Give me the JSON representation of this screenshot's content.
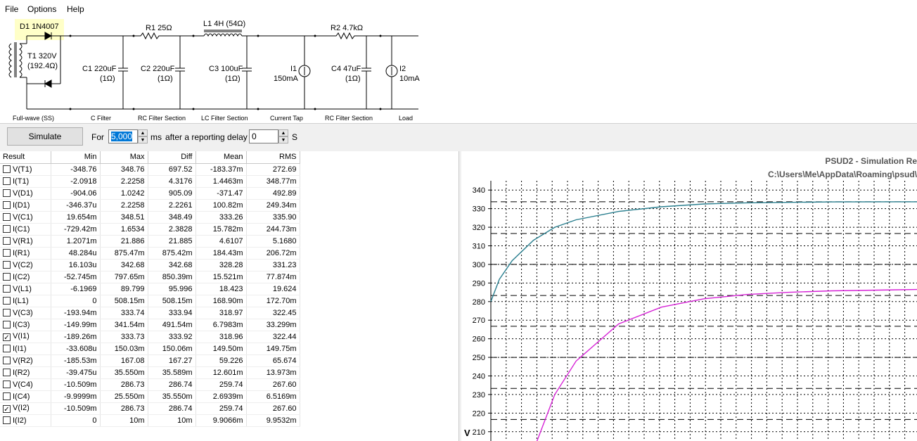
{
  "menu": {
    "file": "File",
    "options": "Options",
    "help": "Help"
  },
  "schematic": {
    "d1": "D1 1N4007",
    "t1_line1": "T1 320V",
    "t1_line2": "(192.4Ω)",
    "r1": "R1 25Ω",
    "l1": "L1 4H (54Ω)",
    "r2": "R2 4.7kΩ",
    "c1_line1": "C1 220uF",
    "c1_line2": "(1Ω)",
    "c2_line1": "C2 220uF",
    "c2_line2": "(1Ω)",
    "c3_line1": "C3 100uF",
    "c3_line2": "(1Ω)",
    "i1_line1": "I1",
    "i1_line2": "150mA",
    "c4_line1": "C4 47uF",
    "c4_line2": "(1Ω)",
    "i2_line1": "I2",
    "i2_line2": "10mA",
    "sections": [
      "Full-wave (SS)",
      "C Filter",
      "RC Filter Section",
      "LC Filter Section",
      "Current Tap",
      "RC Filter Section",
      "Load"
    ]
  },
  "controls": {
    "simulate": "Simulate",
    "for": "For",
    "duration": "5,000",
    "ms": "ms",
    "after": "after a reporting delay of",
    "delay": "0",
    "s": "S"
  },
  "table": {
    "headers": [
      "Result",
      "Min",
      "Max",
      "Diff",
      "Mean",
      "RMS"
    ],
    "rows": [
      {
        "name": "V(T1)",
        "checked": false,
        "min": "-348.76",
        "max": "348.76",
        "diff": "697.52",
        "mean": "-183.37m",
        "rms": "272.69"
      },
      {
        "name": "I(T1)",
        "checked": false,
        "min": "-2.0918",
        "max": "2.2258",
        "diff": "4.3176",
        "mean": "1.4463m",
        "rms": "348.77m"
      },
      {
        "name": "V(D1)",
        "checked": false,
        "min": "-904.06",
        "max": "1.0242",
        "diff": "905.09",
        "mean": "-371.47",
        "rms": "492.89"
      },
      {
        "name": "I(D1)",
        "checked": false,
        "min": "-346.37u",
        "max": "2.2258",
        "diff": "2.2261",
        "mean": "100.82m",
        "rms": "249.34m"
      },
      {
        "name": "V(C1)",
        "checked": false,
        "min": "19.654m",
        "max": "348.51",
        "diff": "348.49",
        "mean": "333.26",
        "rms": "335.90"
      },
      {
        "name": "I(C1)",
        "checked": false,
        "min": "-729.42m",
        "max": "1.6534",
        "diff": "2.3828",
        "mean": "15.782m",
        "rms": "244.73m"
      },
      {
        "name": "V(R1)",
        "checked": false,
        "min": "1.2071m",
        "max": "21.886",
        "diff": "21.885",
        "mean": "4.6107",
        "rms": "5.1680"
      },
      {
        "name": "I(R1)",
        "checked": false,
        "min": "48.284u",
        "max": "875.47m",
        "diff": "875.42m",
        "mean": "184.43m",
        "rms": "206.72m"
      },
      {
        "name": "V(C2)",
        "checked": false,
        "min": "16.103u",
        "max": "342.68",
        "diff": "342.68",
        "mean": "328.28",
        "rms": "331.23"
      },
      {
        "name": "I(C2)",
        "checked": false,
        "min": "-52.745m",
        "max": "797.65m",
        "diff": "850.39m",
        "mean": "15.521m",
        "rms": "77.874m"
      },
      {
        "name": "V(L1)",
        "checked": false,
        "min": "-6.1969",
        "max": "89.799",
        "diff": "95.996",
        "mean": "18.423",
        "rms": "19.624"
      },
      {
        "name": "I(L1)",
        "checked": false,
        "min": "0",
        "max": "508.15m",
        "diff": "508.15m",
        "mean": "168.90m",
        "rms": "172.70m"
      },
      {
        "name": "V(C3)",
        "checked": false,
        "min": "-193.94m",
        "max": "333.74",
        "diff": "333.94",
        "mean": "318.97",
        "rms": "322.45"
      },
      {
        "name": "I(C3)",
        "checked": false,
        "min": "-149.99m",
        "max": "341.54m",
        "diff": "491.54m",
        "mean": "6.7983m",
        "rms": "33.299m"
      },
      {
        "name": "V(I1)",
        "checked": true,
        "min": "-189.26m",
        "max": "333.73",
        "diff": "333.92",
        "mean": "318.96",
        "rms": "322.44"
      },
      {
        "name": "I(I1)",
        "checked": false,
        "min": "-33.608u",
        "max": "150.03m",
        "diff": "150.06m",
        "mean": "149.50m",
        "rms": "149.75m"
      },
      {
        "name": "V(R2)",
        "checked": false,
        "min": "-185.53m",
        "max": "167.08",
        "diff": "167.27",
        "mean": "59.226",
        "rms": "65.674"
      },
      {
        "name": "I(R2)",
        "checked": false,
        "min": "-39.475u",
        "max": "35.550m",
        "diff": "35.589m",
        "mean": "12.601m",
        "rms": "13.973m"
      },
      {
        "name": "V(C4)",
        "checked": false,
        "min": "-10.509m",
        "max": "286.73",
        "diff": "286.74",
        "mean": "259.74",
        "rms": "267.60"
      },
      {
        "name": "I(C4)",
        "checked": false,
        "min": "-9.9999m",
        "max": "25.550m",
        "diff": "35.550m",
        "mean": "2.6939m",
        "rms": "6.5169m"
      },
      {
        "name": "V(I2)",
        "checked": true,
        "min": "-10.509m",
        "max": "286.73",
        "diff": "286.74",
        "mean": "259.74",
        "rms": "267.60"
      },
      {
        "name": "I(I2)",
        "checked": false,
        "min": "0",
        "max": "10m",
        "diff": "10m",
        "mean": "9.9066m",
        "rms": "9.9532m"
      }
    ]
  },
  "graph": {
    "title1": "PSUD2 - Simulation Re",
    "title2": "C:\\Users\\Me\\AppData\\Roaming\\psud\\",
    "ylabel": "V",
    "yticks": [
      "340",
      "330",
      "320",
      "310",
      "300",
      "290",
      "280",
      "270",
      "260",
      "250",
      "240",
      "230",
      "220",
      "210"
    ]
  },
  "chart_data": {
    "type": "line",
    "ylabel": "V",
    "ylim": [
      205,
      345
    ],
    "yticks": [
      340,
      330,
      320,
      310,
      300,
      290,
      280,
      270,
      260,
      250,
      240,
      230,
      220,
      210
    ],
    "grid": true,
    "series": [
      {
        "color": "#2a7f8f",
        "x": [
          0,
          0.02,
          0.05,
          0.1,
          0.15,
          0.2,
          0.3,
          0.4,
          0.5,
          0.6,
          0.7,
          0.8,
          1.0
        ],
        "y": [
          280,
          292,
          302,
          313,
          320,
          324,
          328.5,
          331,
          332.5,
          333.1,
          333.4,
          333.6,
          333.7
        ]
      },
      {
        "color": "#d623d6",
        "x": [
          0.1,
          0.15,
          0.2,
          0.3,
          0.4,
          0.5,
          0.6,
          0.7,
          0.8,
          1.0
        ],
        "y": [
          200,
          230,
          248,
          268,
          277,
          281.5,
          283.8,
          285,
          285.8,
          286.5
        ]
      }
    ],
    "dashed_reference_levels": [
      333.7,
      316.6,
      300,
      283.3,
      266.7,
      250,
      233.3,
      216.6
    ]
  }
}
